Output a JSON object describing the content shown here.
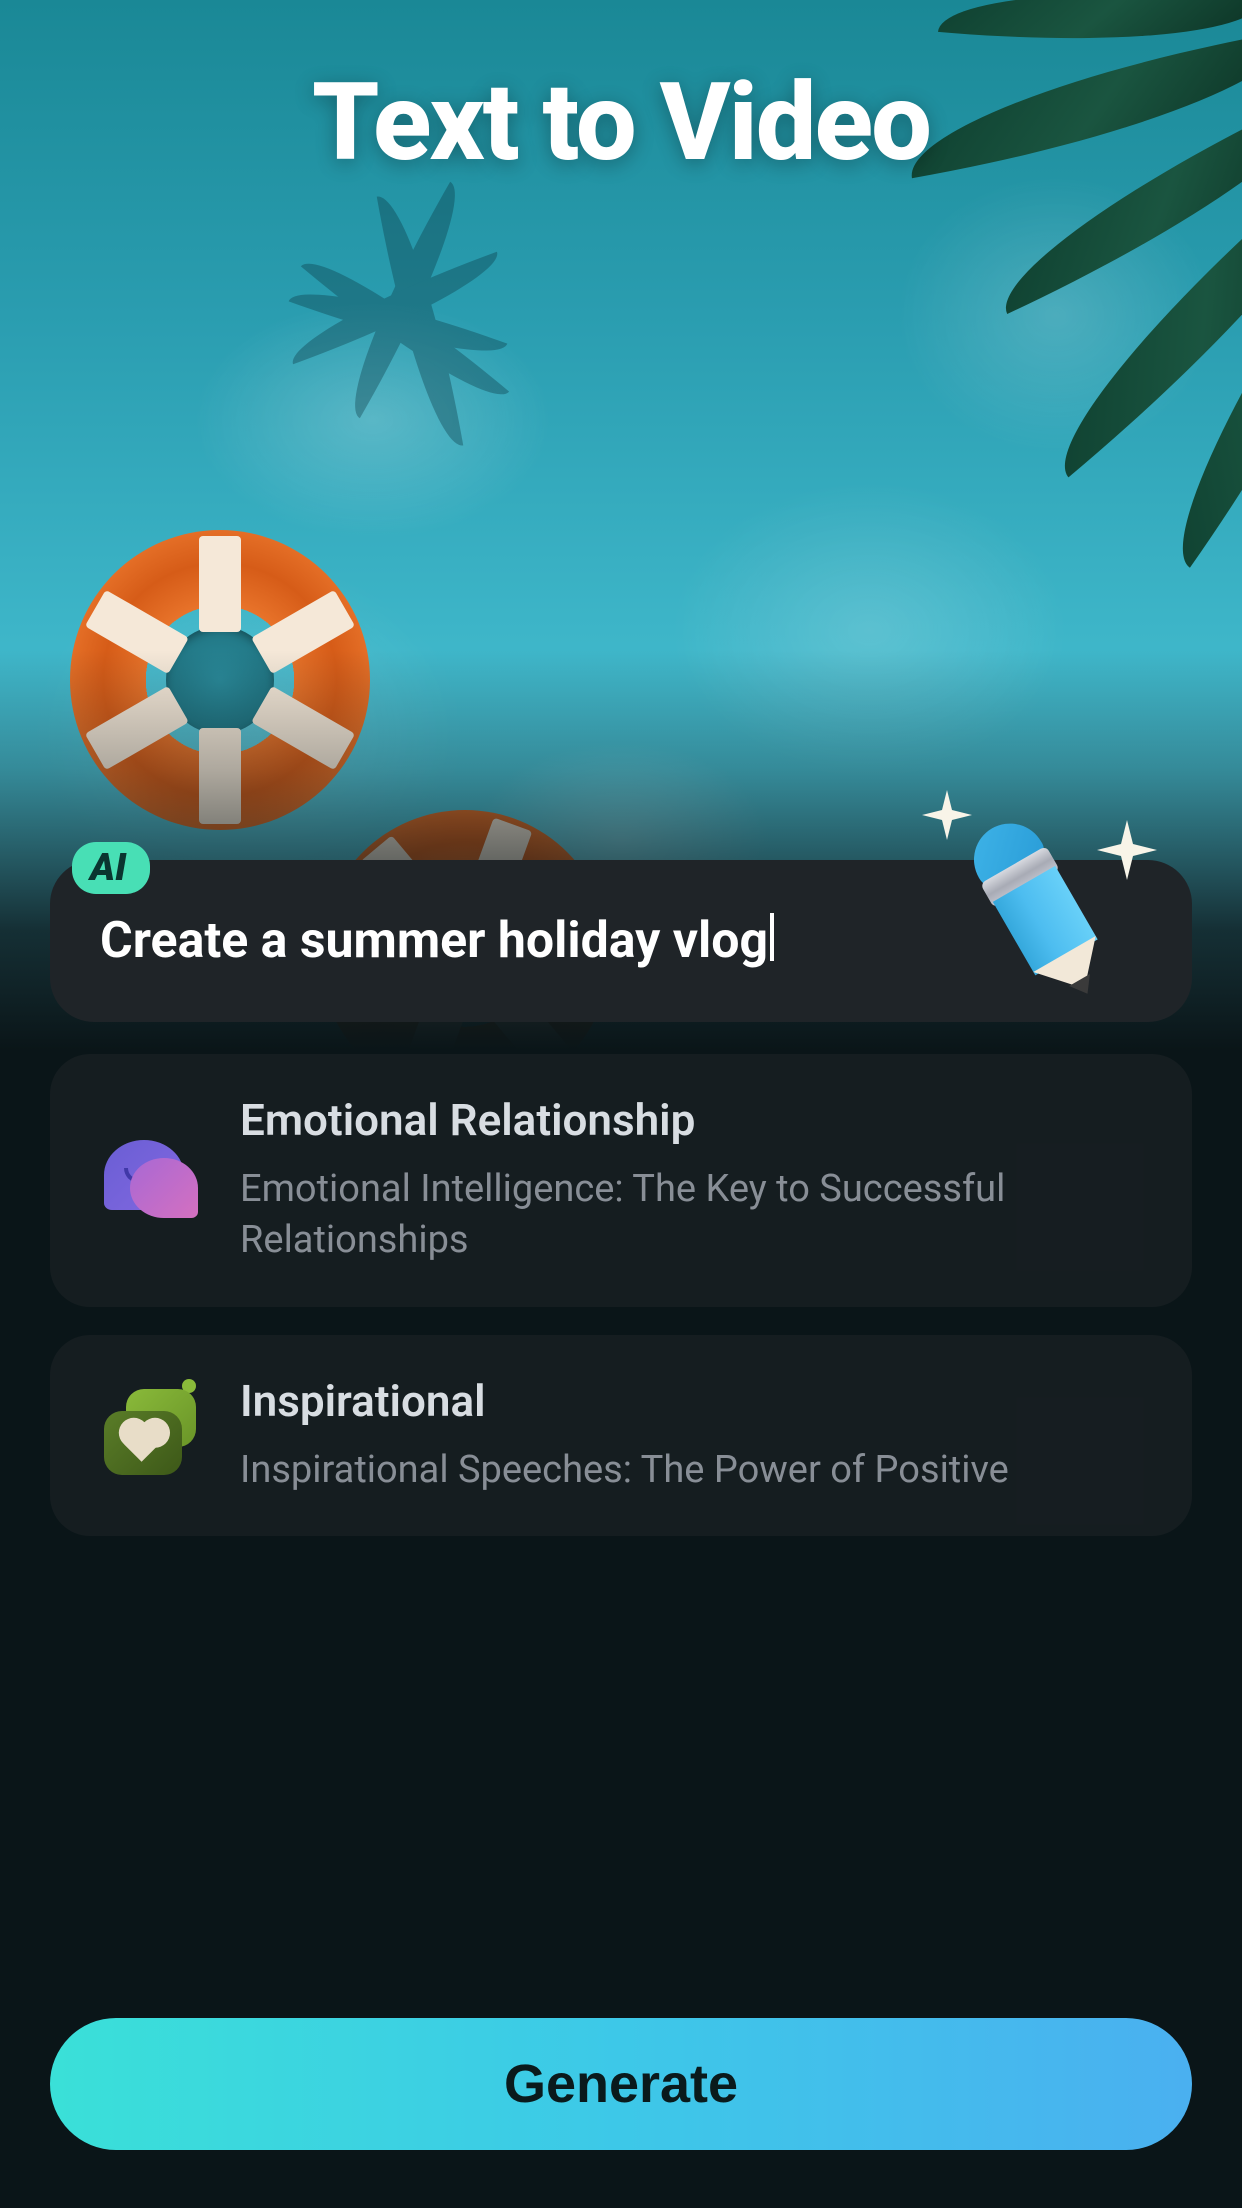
{
  "header": {
    "title": "Text to Video"
  },
  "prompt": {
    "ai_badge": "AI",
    "text": "Create a summer holiday vlog"
  },
  "categories": [
    {
      "icon": "chat-bubbles-icon",
      "title": "Emotional Relationship",
      "subtitle": "Emotional Intelligence: The Key to Successful Relationships"
    },
    {
      "icon": "heart-message-icon",
      "title": "Inspirational",
      "subtitle": "Inspirational Speeches: The Power of Positive"
    }
  ],
  "actions": {
    "generate": "Generate"
  }
}
